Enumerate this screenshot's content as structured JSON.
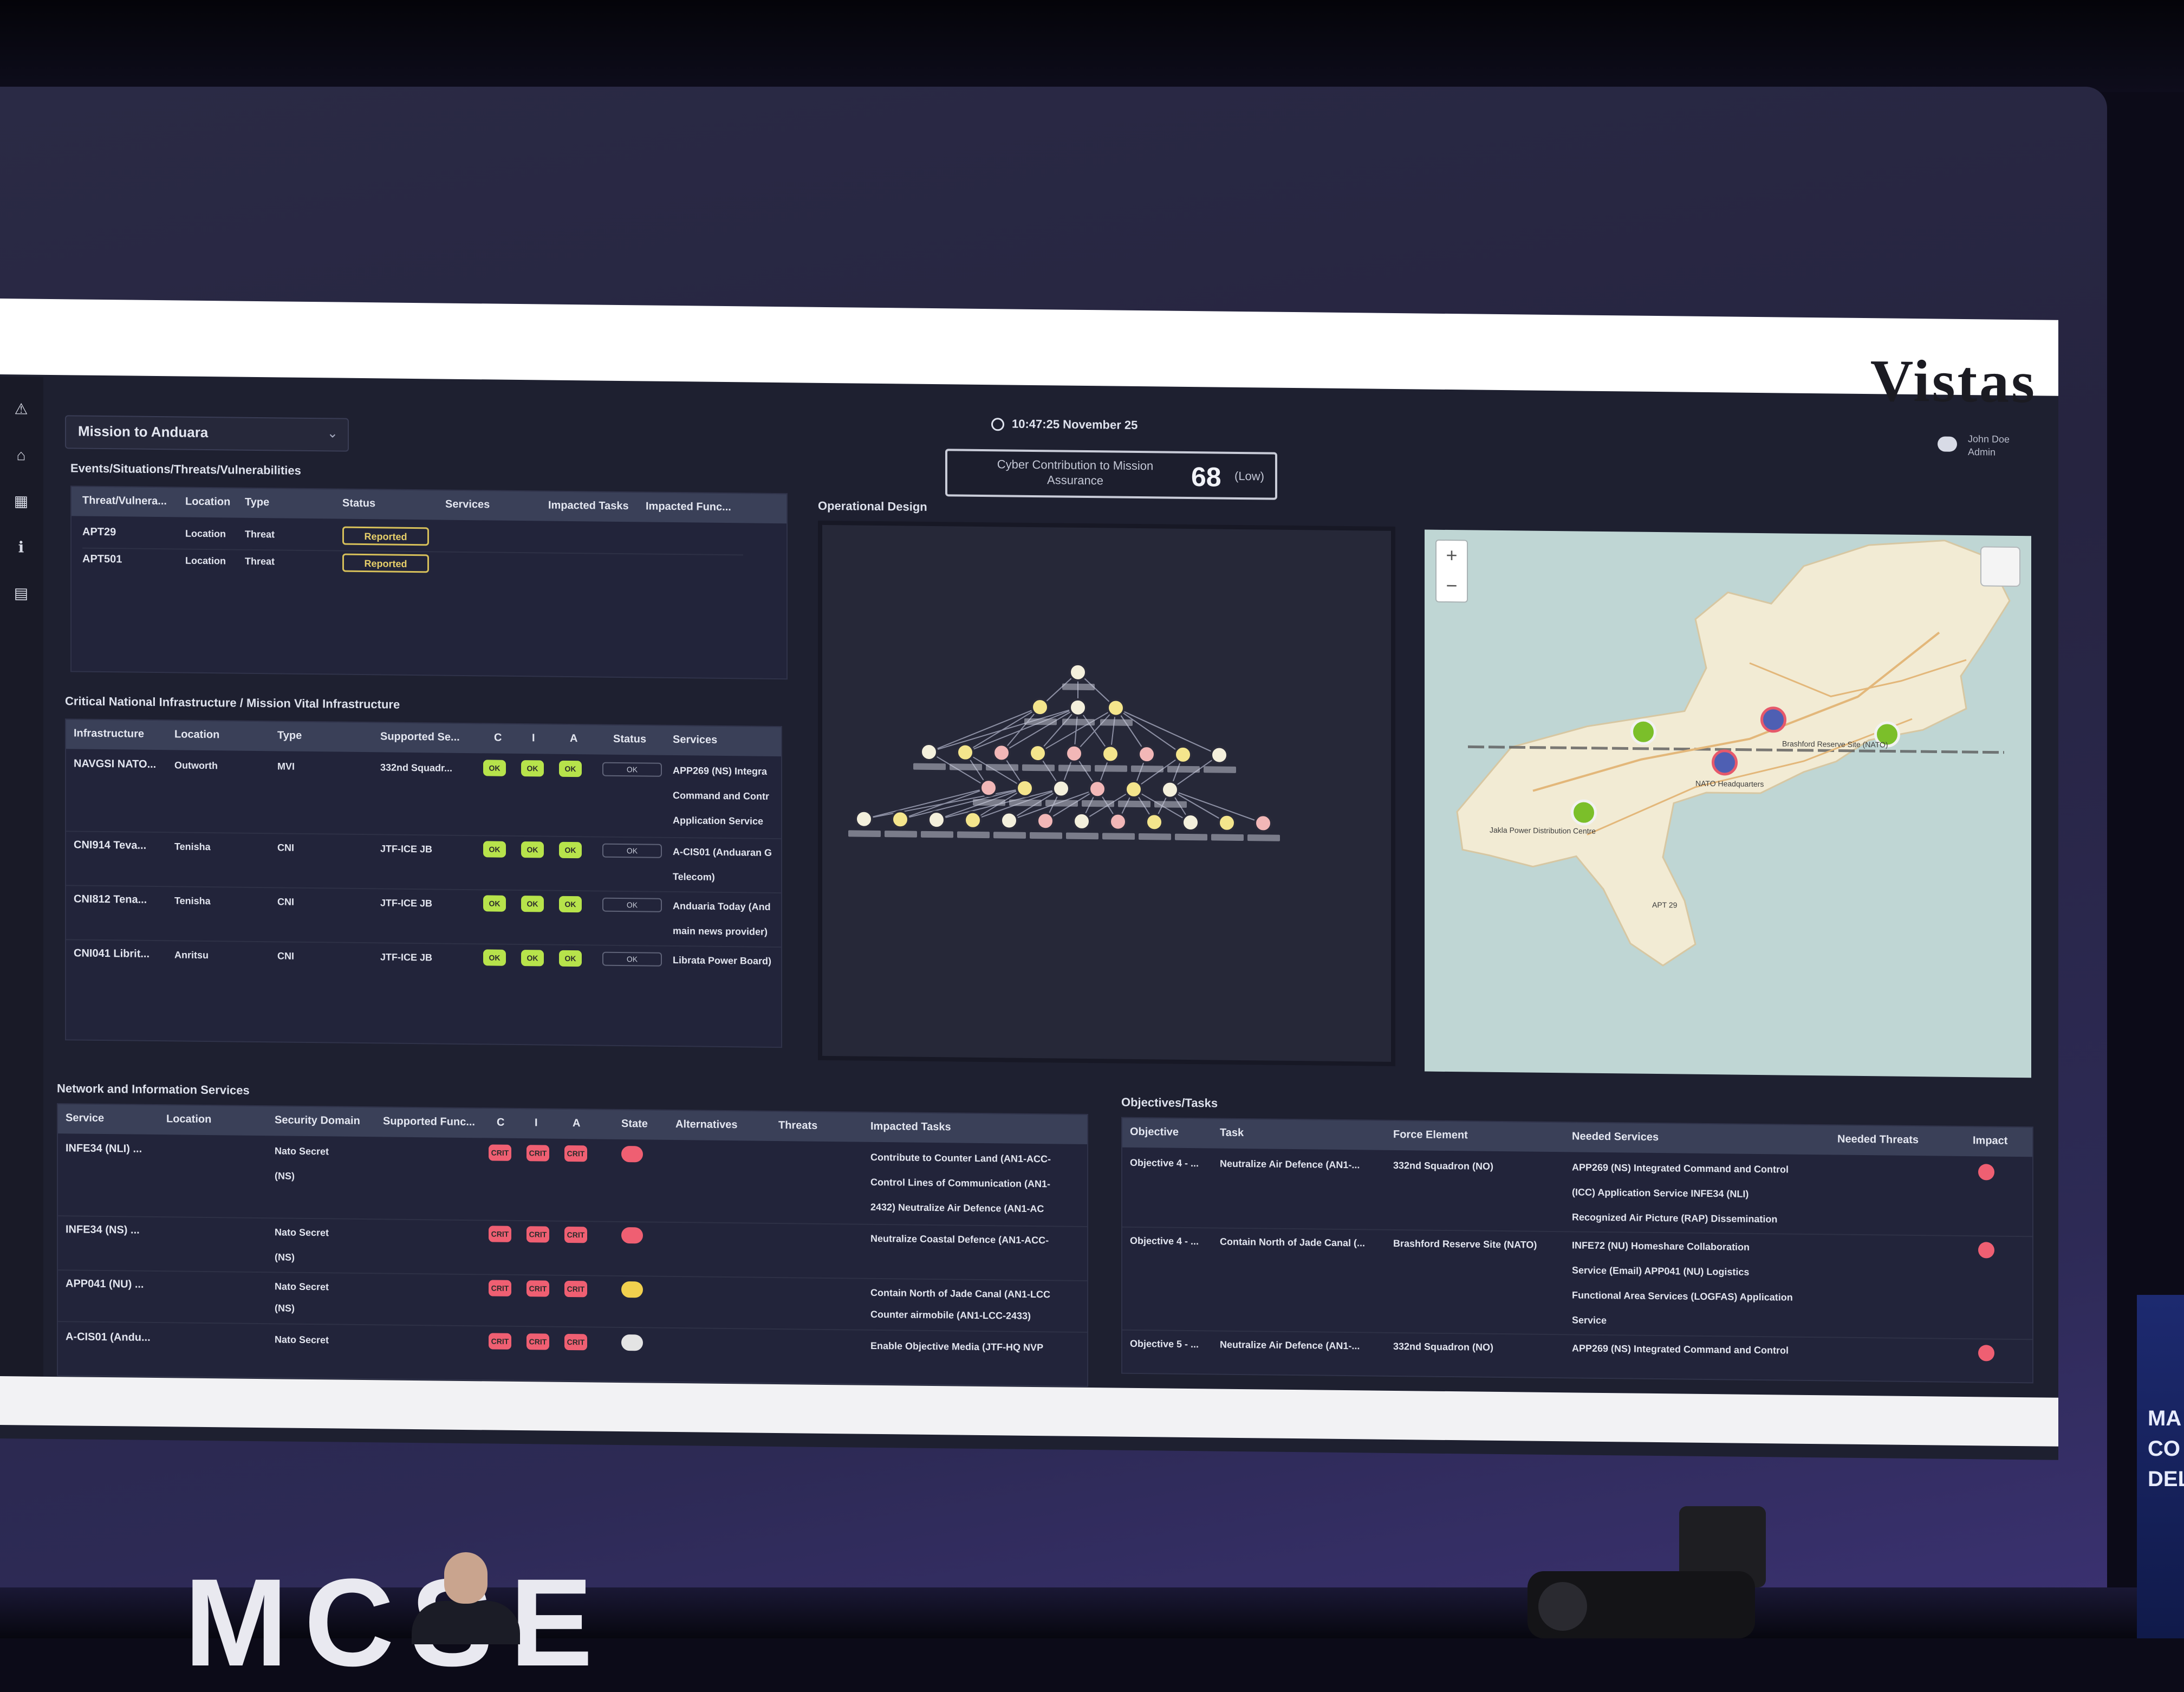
{
  "stage": {
    "big_letters": "MCSE",
    "side_banner_lines": [
      "MA",
      "CO",
      "DEL"
    ]
  },
  "app": {
    "brand": "Vistas",
    "mission_select": {
      "value": "Mission to Anduara"
    },
    "clock": "10:47:25 November 25",
    "user": {
      "name": "John Doe",
      "role": "Admin"
    },
    "score": {
      "title": "Cyber Contribution to Mission Assurance",
      "value": "68",
      "level": "(Low)"
    },
    "rail_icons": [
      "warning-icon",
      "home-icon",
      "dashboard-icon",
      "info-icon",
      "document-icon"
    ],
    "colors": {
      "ok": "#b7e34b",
      "critical": "#ef5f72",
      "warning": "#f1d04e",
      "reported": "#e8d06a"
    }
  },
  "events": {
    "title": "Events/Situations/Threats/Vulnerabilities",
    "columns": [
      "Threat/Vulnera...",
      "Location",
      "Type",
      "Status",
      "Services",
      "Impacted Tasks",
      "Impacted Func..."
    ],
    "rows": [
      {
        "name": "APT29",
        "location": "Location",
        "type": "Threat",
        "status": "Reported"
      },
      {
        "name": "APT501",
        "location": "Location",
        "type": "Threat",
        "status": "Reported"
      }
    ]
  },
  "infra": {
    "title": "Critical National Infrastructure / Mission Vital Infrastructure",
    "columns": [
      "Infrastructure",
      "Location",
      "Type",
      "Supported Se...",
      "C",
      "I",
      "A",
      "Status",
      "Services"
    ],
    "rows": [
      {
        "name": "NAVGSI NATO...",
        "location": "Outworth",
        "type": "MVI",
        "supported": "332nd Squadr...",
        "c": "OK",
        "i": "OK",
        "a": "OK",
        "status": "OK",
        "services": [
          "APP269 (NS) Integra",
          "Command and Contr",
          "Application Service"
        ]
      },
      {
        "name": "CNI914 Teva...",
        "location": "Tenisha",
        "type": "CNI",
        "supported": "JTF-ICE JB",
        "c": "OK",
        "i": "OK",
        "a": "OK",
        "status": "OK",
        "services": [
          "A-CIS01 (Anduaran G",
          "Telecom)"
        ]
      },
      {
        "name": "CNI812 Tena...",
        "location": "Tenisha",
        "type": "CNI",
        "supported": "JTF-ICE JB",
        "c": "OK",
        "i": "OK",
        "a": "OK",
        "status": "OK",
        "services": [
          "Anduaria Today (And",
          "main news provider)"
        ]
      },
      {
        "name": "CNI041 Librit...",
        "location": "Anritsu",
        "type": "CNI",
        "supported": "JTF-ICE JB",
        "c": "OK",
        "i": "OK",
        "a": "OK",
        "status": "OK",
        "services": [
          "Librata Power Board)"
        ]
      }
    ]
  },
  "opdesign": {
    "title": "Operational Design"
  },
  "map": {
    "zoom_in": "+",
    "zoom_out": "−",
    "labels": [
      "Brashford Reserve Site (NATO)",
      "NATO Headquarters",
      "Jakla Power Distribution Centre",
      "APT 29"
    ]
  },
  "network": {
    "title": "Network and Information Services",
    "columns": [
      "Service",
      "Location",
      "Security Domain",
      "Supported Func...",
      "C",
      "I",
      "A",
      "State",
      "Alternatives",
      "Threats",
      "Impacted Tasks"
    ],
    "rows": [
      {
        "service": "INFE34 (NLI) ...",
        "domain": [
          "Nato Secret",
          "(NS)"
        ],
        "c": "CRIT",
        "i": "CRIT",
        "a": "CRIT",
        "state": "red",
        "tasks": [
          "Contribute to Counter Land (AN1-ACC-",
          "Control Lines of Communication (AN1-",
          "2432) Neutralize Air Defence (AN1-AC"
        ]
      },
      {
        "service": "INFE34 (NS) ...",
        "domain": [
          "Nato Secret",
          "(NS)"
        ],
        "c": "CRIT",
        "i": "CRIT",
        "a": "CRIT",
        "state": "red",
        "tasks": [
          "Neutralize Coastal Defence (AN1-ACC-"
        ]
      },
      {
        "service": "APP041 (NU) ...",
        "domain": [
          "Nato Secret",
          "(NS)"
        ],
        "c": "CRIT",
        "i": "CRIT",
        "a": "CRIT",
        "state": "yellow",
        "tasks": [
          "Contain North of Jade Canal (AN1-LCC",
          "Counter airmobile (AN1-LCC-2433)"
        ]
      },
      {
        "service": "A-CIS01 (Andu...",
        "domain": [
          "Nato Secret"
        ],
        "c": "CRIT",
        "i": "CRIT",
        "a": "CRIT",
        "state": "white",
        "tasks": [
          "Enable Objective Media (JTF-HQ NVP"
        ]
      }
    ]
  },
  "objectives": {
    "title": "Objectives/Tasks",
    "columns": [
      "Objective",
      "Task",
      "Force Element",
      "Needed Services",
      "Needed Threats",
      "Impact"
    ],
    "rows": [
      {
        "objective": "Objective 4 - ...",
        "task": "Neutralize Air Defence (AN1-...",
        "force": "332nd Squadron (NO)",
        "services": [
          "APP269 (NS) Integrated Command and Control",
          "(ICC) Application Service INFE34 (NLI)",
          "Recognized Air Picture (RAP) Dissemination"
        ]
      },
      {
        "objective": "Objective 4 - ...",
        "task": "Contain North of Jade Canal (...",
        "force": "Brashford Reserve Site (NATO)",
        "services": [
          "INFE72 (NU) Homeshare Collaboration",
          "Service (Email) APP041 (NU) Logistics",
          "Functional Area Services (LOGFAS) Application",
          "Service"
        ]
      },
      {
        "objective": "Objective 5 - ...",
        "task": "Neutralize Air Defence (AN1-...",
        "force": "332nd Squadron (NO)",
        "services": [
          "APP269 (NS) Integrated Command and Control"
        ]
      }
    ]
  }
}
